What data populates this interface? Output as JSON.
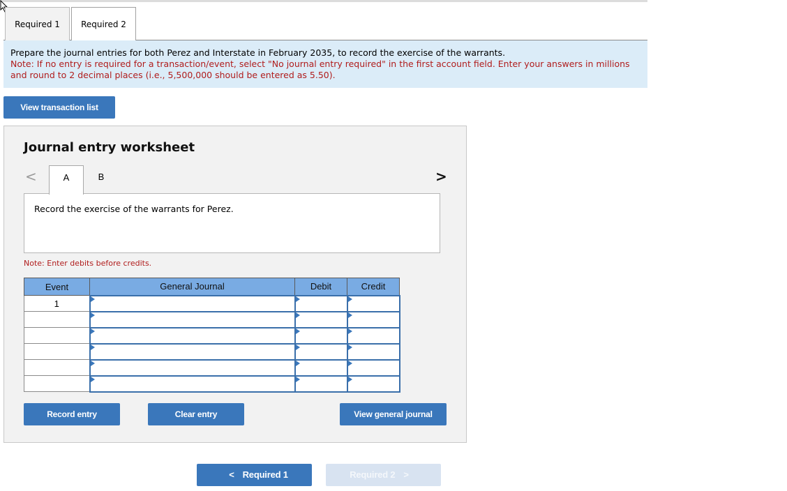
{
  "required_tabs": [
    {
      "label": "Required 1",
      "active": false
    },
    {
      "label": "Required 2",
      "active": true
    }
  ],
  "instructions": {
    "main": "Prepare the journal entries for both Perez and Interstate in February 2035, to record the exercise of the warrants.",
    "note": "Note: If no entry is required for a transaction/event, select \"No journal entry required\" in the first account field. Enter your answers in millions and round to 2 decimal places (i.e., 5,500,000 should be entered as 5.50)."
  },
  "view_transaction_list_label": "View transaction list",
  "worksheet": {
    "title": "Journal entry worksheet",
    "event_tabs": [
      {
        "label": "A",
        "active": true
      },
      {
        "label": "B",
        "active": false
      }
    ],
    "prev_glyph": "<",
    "next_glyph": ">",
    "description": "Record the exercise of the warrants for Perez.",
    "note": "Note: Enter debits before credits.",
    "table": {
      "headers": [
        "Event",
        "General Journal",
        "Debit",
        "Credit"
      ],
      "rows": [
        {
          "event": "1",
          "account": "",
          "debit": "",
          "credit": ""
        },
        {
          "event": "",
          "account": "",
          "debit": "",
          "credit": ""
        },
        {
          "event": "",
          "account": "",
          "debit": "",
          "credit": ""
        },
        {
          "event": "",
          "account": "",
          "debit": "",
          "credit": ""
        },
        {
          "event": "",
          "account": "",
          "debit": "",
          "credit": ""
        },
        {
          "event": "",
          "account": "",
          "debit": "",
          "credit": ""
        }
      ]
    },
    "buttons": {
      "record": "Record entry",
      "clear": "Clear entry",
      "view_general_journal": "View general journal"
    }
  },
  "bottom_nav": {
    "prev_label": "Required 1",
    "next_label": "Required 2",
    "prev_glyph": "<",
    "next_glyph": ">",
    "next_enabled": false
  },
  "colors": {
    "button_blue": "#3a77bb",
    "instruction_bg": "#dbecf8",
    "note_red": "#b01c1c",
    "table_header_blue": "#79abe3"
  }
}
